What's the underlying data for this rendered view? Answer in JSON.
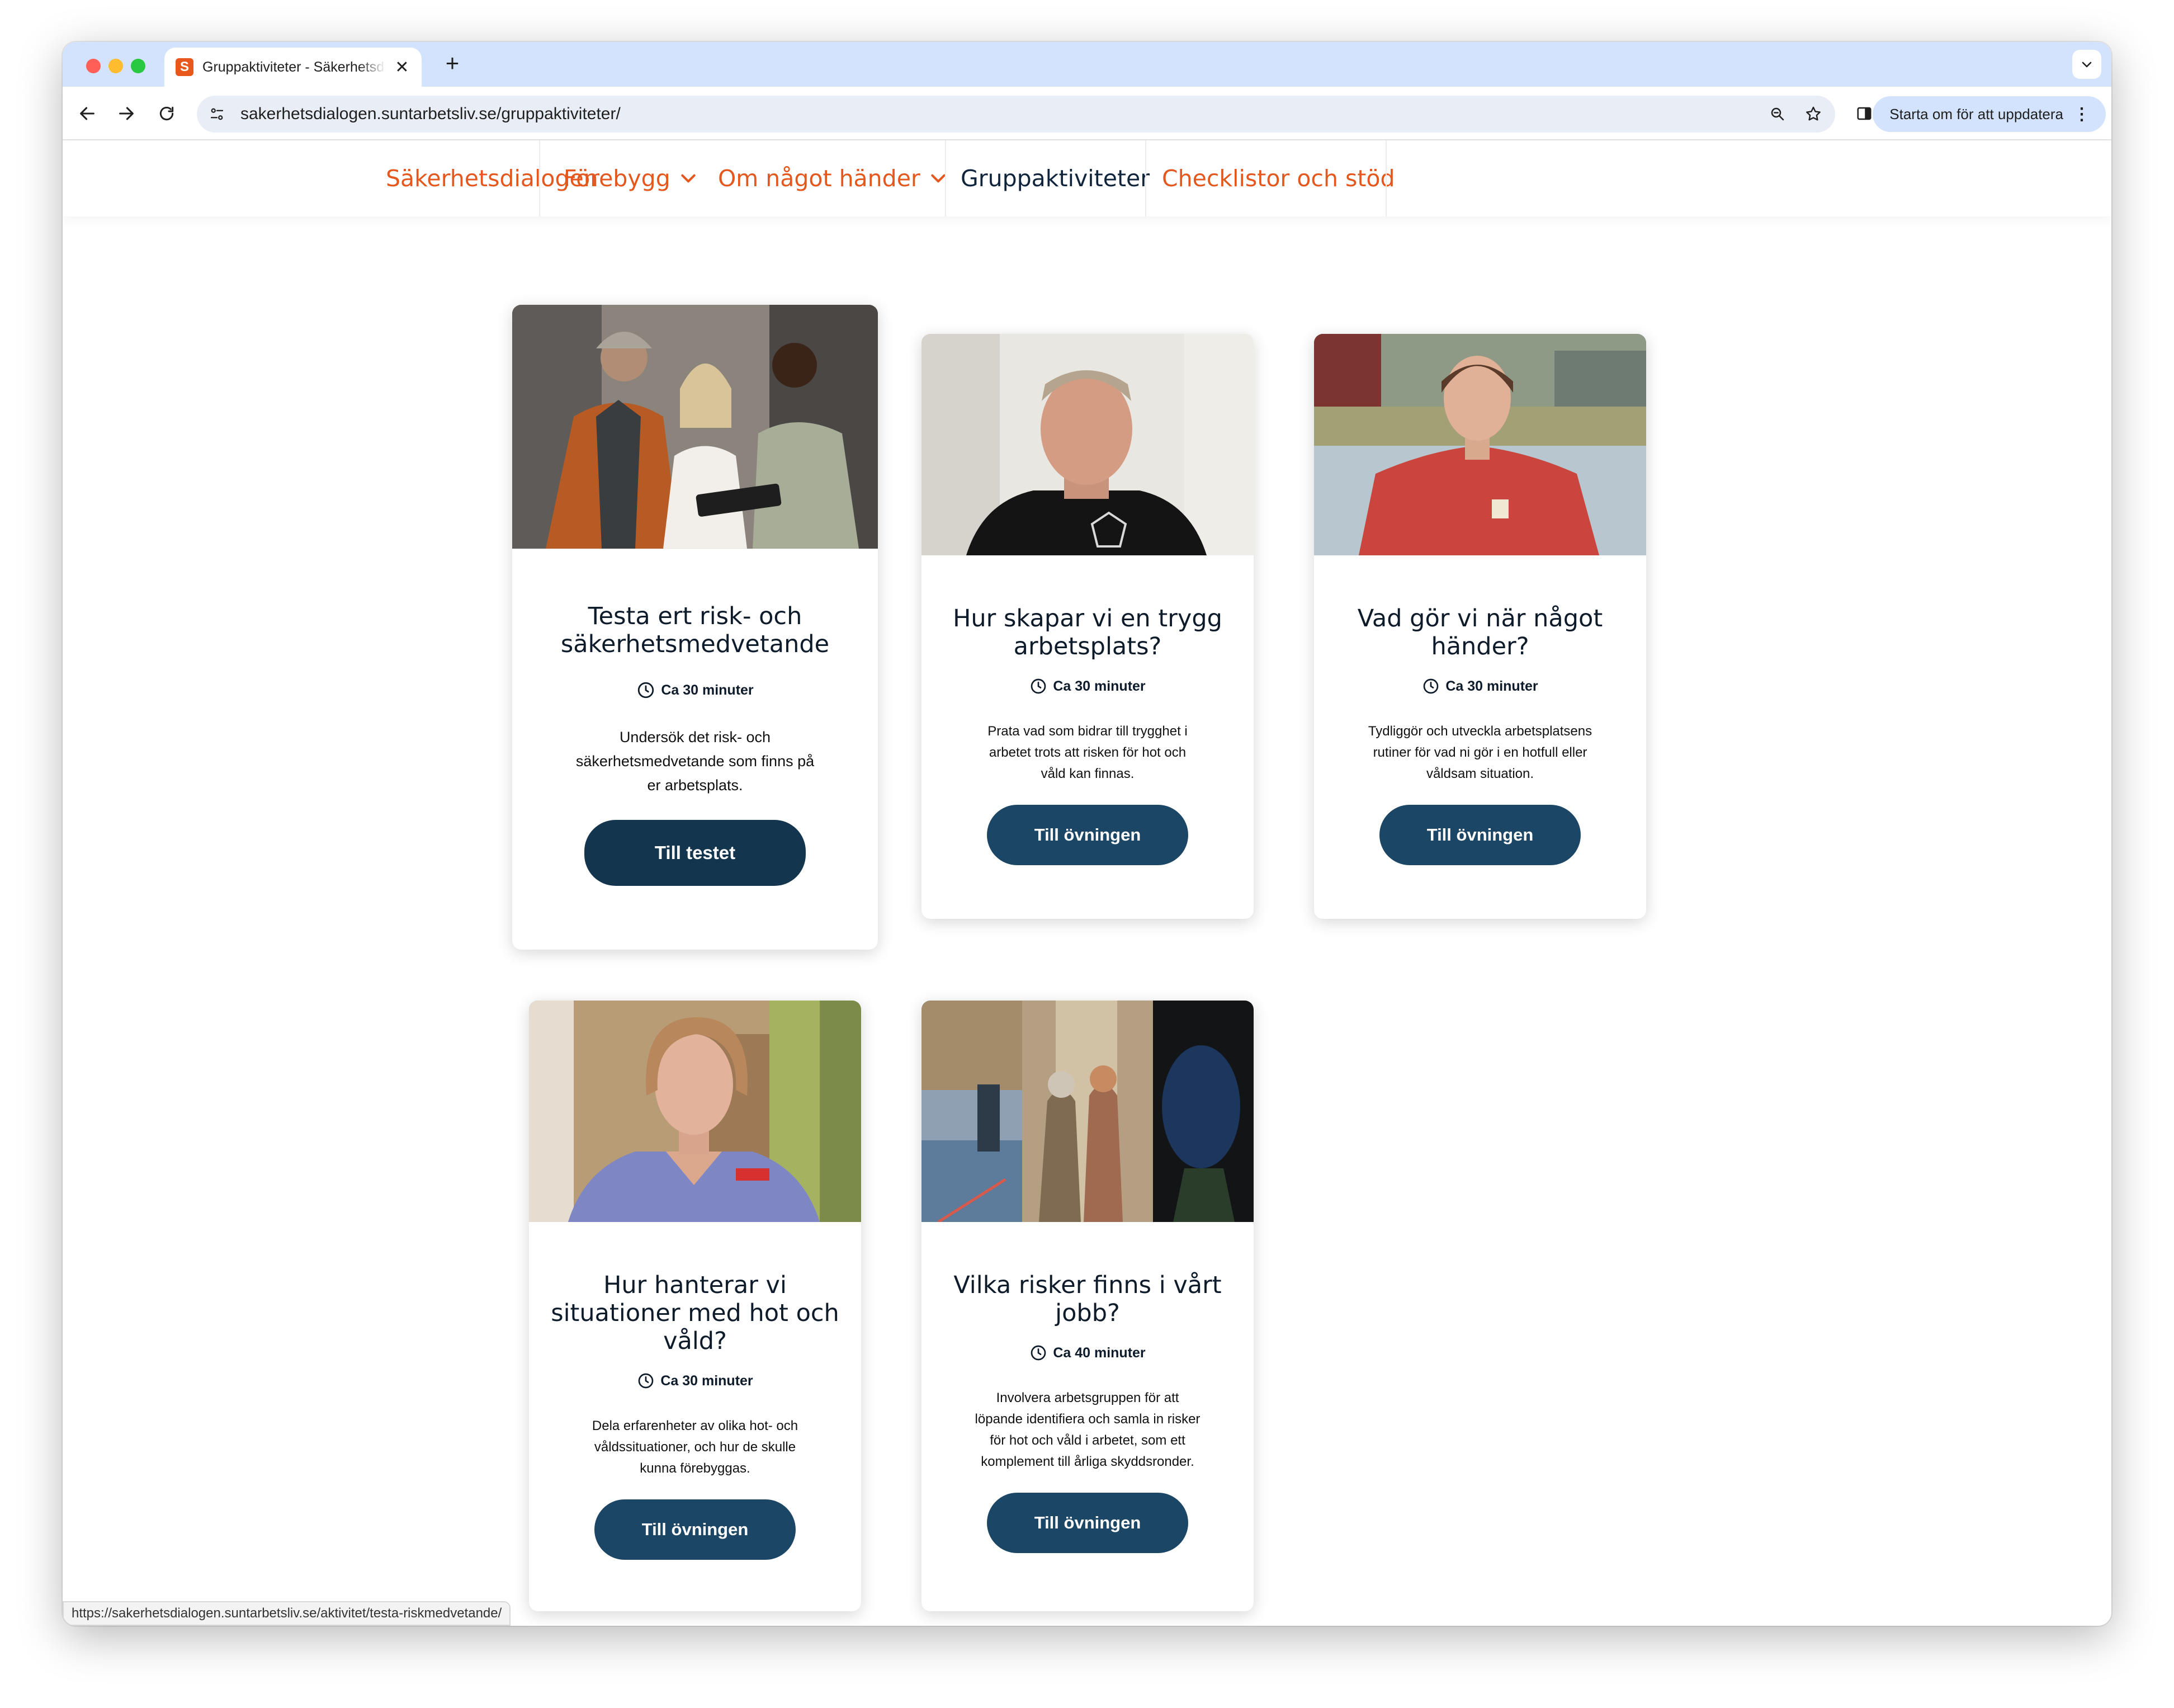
{
  "browser": {
    "tab_title": "Gruppaktiviteter - Säkerhetsdialogen",
    "favicon_letter": "S",
    "url": "sakerhetsdialogen.suntarbetsliv.se/gruppaktiviteter/",
    "update_button": "Starta om för att uppdatera",
    "status_url": "https://sakerhetsdialogen.suntarbetsliv.se/aktivitet/testa-riskmedvetande/"
  },
  "nav": {
    "items": [
      {
        "label": "Säkerhetsdialogen",
        "dropdown": false,
        "active": false
      },
      {
        "label": "Förebygg",
        "dropdown": true,
        "active": false
      },
      {
        "label": "Om något händer",
        "dropdown": true,
        "active": false
      },
      {
        "label": "Gruppaktiviteter",
        "dropdown": false,
        "active": true
      },
      {
        "label": "Checklistor och stöd",
        "dropdown": false,
        "active": false
      }
    ],
    "accent_color": "#e4571d",
    "active_color": "#10243c"
  },
  "cards": [
    {
      "title_lines": [
        "Testa ert risk- och",
        "säkerhetsmedvetande"
      ],
      "time": "Ca 30 minuter",
      "desc_lines": [
        "Undersök det risk- och",
        "säkerhetsmedvetande som finns på",
        "er arbetsplats."
      ],
      "button": "Till testet",
      "image": "three-colleagues-reviewing-clipboard"
    },
    {
      "title_lines": [
        "Hur skapar vi en trygg",
        "arbetsplats?"
      ],
      "time": "Ca 30 minuter",
      "desc_lines": [
        "Prata vad som bidrar till trygghet i",
        "arbetet trots att risken för hot och",
        "våld kan finnas."
      ],
      "button": "Till övningen",
      "image": "man-in-black-tshirt-portrait"
    },
    {
      "title_lines": [
        "Vad gör vi när något",
        "händer?"
      ],
      "time": "Ca 30 minuter",
      "desc_lines": [
        "Tydliggör och utveckla arbetsplatsens",
        "rutiner för vad ni gör i en hotfull eller",
        "våldsam situation."
      ],
      "button": "Till övningen",
      "image": "woman-in-red-jacket-by-pool"
    },
    {
      "title_lines": [
        "Hur hanterar vi",
        "situationer med hot och",
        "våld?"
      ],
      "time": "Ca 30 minuter",
      "desc_lines": [
        "Dela erfarenheter av olika hot- och",
        "våldssituationer, och hur de skulle",
        "kunna förebyggas."
      ],
      "button": "Till övningen",
      "image": "nurse-in-blue-scrubs-portrait"
    },
    {
      "title_lines": [
        "Vilka risker finns i vårt",
        "jobb?"
      ],
      "time": "Ca 40 minuter",
      "desc_lines": [
        "Involvera arbetsgruppen för att",
        "löpande identifiera och samla in risker",
        "för hot och våld i arbetet, som ett",
        "komplement till årliga skyddsronder."
      ],
      "button": "Till övningen",
      "image": "collage-cleaner-elderly-night-worker"
    }
  ]
}
